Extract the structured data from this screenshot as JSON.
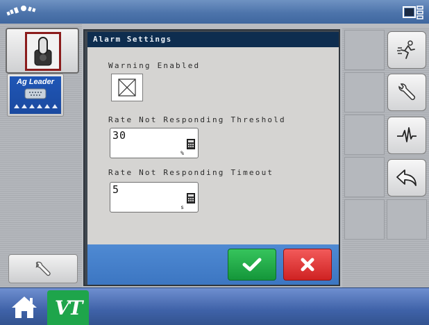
{
  "dialog": {
    "title": "Alarm Settings",
    "warning_label": "Warning Enabled",
    "threshold_label": "Rate Not Responding Threshold",
    "threshold_value": "30",
    "threshold_unit": "%",
    "timeout_label": "Rate Not Responding Timeout",
    "timeout_value": "5",
    "timeout_unit": "s"
  },
  "sidebar": {
    "agleader_text": "Ag Leader"
  },
  "taskbar": {
    "vt_label": "VT"
  },
  "colors": {
    "ok": "#1ea54b",
    "cancel": "#e03b3b",
    "title_bar": "#0e2d4f",
    "footer": "#4a86d0"
  }
}
